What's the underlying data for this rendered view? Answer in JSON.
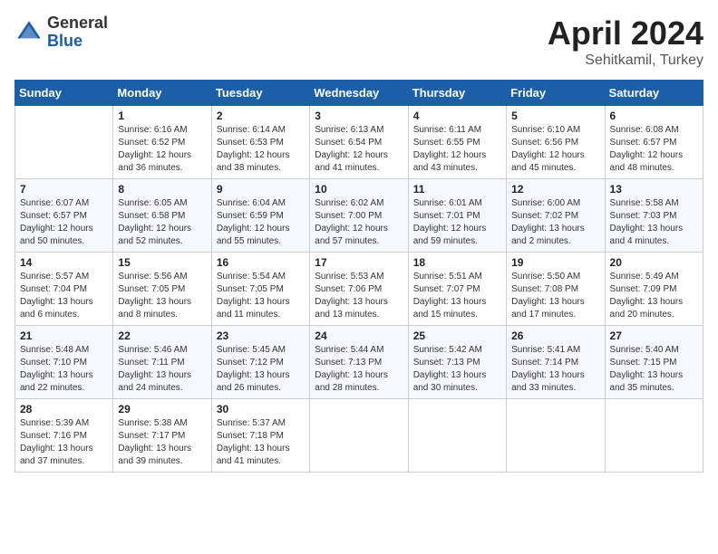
{
  "header": {
    "logo_general": "General",
    "logo_blue": "Blue",
    "month": "April 2024",
    "location": "Sehitkamil, Turkey"
  },
  "weekdays": [
    "Sunday",
    "Monday",
    "Tuesday",
    "Wednesday",
    "Thursday",
    "Friday",
    "Saturday"
  ],
  "weeks": [
    [
      {
        "day": "",
        "info": ""
      },
      {
        "day": "1",
        "info": "Sunrise: 6:16 AM\nSunset: 6:52 PM\nDaylight: 12 hours\nand 36 minutes."
      },
      {
        "day": "2",
        "info": "Sunrise: 6:14 AM\nSunset: 6:53 PM\nDaylight: 12 hours\nand 38 minutes."
      },
      {
        "day": "3",
        "info": "Sunrise: 6:13 AM\nSunset: 6:54 PM\nDaylight: 12 hours\nand 41 minutes."
      },
      {
        "day": "4",
        "info": "Sunrise: 6:11 AM\nSunset: 6:55 PM\nDaylight: 12 hours\nand 43 minutes."
      },
      {
        "day": "5",
        "info": "Sunrise: 6:10 AM\nSunset: 6:56 PM\nDaylight: 12 hours\nand 45 minutes."
      },
      {
        "day": "6",
        "info": "Sunrise: 6:08 AM\nSunset: 6:57 PM\nDaylight: 12 hours\nand 48 minutes."
      }
    ],
    [
      {
        "day": "7",
        "info": "Sunrise: 6:07 AM\nSunset: 6:57 PM\nDaylight: 12 hours\nand 50 minutes."
      },
      {
        "day": "8",
        "info": "Sunrise: 6:05 AM\nSunset: 6:58 PM\nDaylight: 12 hours\nand 52 minutes."
      },
      {
        "day": "9",
        "info": "Sunrise: 6:04 AM\nSunset: 6:59 PM\nDaylight: 12 hours\nand 55 minutes."
      },
      {
        "day": "10",
        "info": "Sunrise: 6:02 AM\nSunset: 7:00 PM\nDaylight: 12 hours\nand 57 minutes."
      },
      {
        "day": "11",
        "info": "Sunrise: 6:01 AM\nSunset: 7:01 PM\nDaylight: 12 hours\nand 59 minutes."
      },
      {
        "day": "12",
        "info": "Sunrise: 6:00 AM\nSunset: 7:02 PM\nDaylight: 13 hours\nand 2 minutes."
      },
      {
        "day": "13",
        "info": "Sunrise: 5:58 AM\nSunset: 7:03 PM\nDaylight: 13 hours\nand 4 minutes."
      }
    ],
    [
      {
        "day": "14",
        "info": "Sunrise: 5:57 AM\nSunset: 7:04 PM\nDaylight: 13 hours\nand 6 minutes."
      },
      {
        "day": "15",
        "info": "Sunrise: 5:56 AM\nSunset: 7:05 PM\nDaylight: 13 hours\nand 8 minutes."
      },
      {
        "day": "16",
        "info": "Sunrise: 5:54 AM\nSunset: 7:05 PM\nDaylight: 13 hours\nand 11 minutes."
      },
      {
        "day": "17",
        "info": "Sunrise: 5:53 AM\nSunset: 7:06 PM\nDaylight: 13 hours\nand 13 minutes."
      },
      {
        "day": "18",
        "info": "Sunrise: 5:51 AM\nSunset: 7:07 PM\nDaylight: 13 hours\nand 15 minutes."
      },
      {
        "day": "19",
        "info": "Sunrise: 5:50 AM\nSunset: 7:08 PM\nDaylight: 13 hours\nand 17 minutes."
      },
      {
        "day": "20",
        "info": "Sunrise: 5:49 AM\nSunset: 7:09 PM\nDaylight: 13 hours\nand 20 minutes."
      }
    ],
    [
      {
        "day": "21",
        "info": "Sunrise: 5:48 AM\nSunset: 7:10 PM\nDaylight: 13 hours\nand 22 minutes."
      },
      {
        "day": "22",
        "info": "Sunrise: 5:46 AM\nSunset: 7:11 PM\nDaylight: 13 hours\nand 24 minutes."
      },
      {
        "day": "23",
        "info": "Sunrise: 5:45 AM\nSunset: 7:12 PM\nDaylight: 13 hours\nand 26 minutes."
      },
      {
        "day": "24",
        "info": "Sunrise: 5:44 AM\nSunset: 7:13 PM\nDaylight: 13 hours\nand 28 minutes."
      },
      {
        "day": "25",
        "info": "Sunrise: 5:42 AM\nSunset: 7:13 PM\nDaylight: 13 hours\nand 30 minutes."
      },
      {
        "day": "26",
        "info": "Sunrise: 5:41 AM\nSunset: 7:14 PM\nDaylight: 13 hours\nand 33 minutes."
      },
      {
        "day": "27",
        "info": "Sunrise: 5:40 AM\nSunset: 7:15 PM\nDaylight: 13 hours\nand 35 minutes."
      }
    ],
    [
      {
        "day": "28",
        "info": "Sunrise: 5:39 AM\nSunset: 7:16 PM\nDaylight: 13 hours\nand 37 minutes."
      },
      {
        "day": "29",
        "info": "Sunrise: 5:38 AM\nSunset: 7:17 PM\nDaylight: 13 hours\nand 39 minutes."
      },
      {
        "day": "30",
        "info": "Sunrise: 5:37 AM\nSunset: 7:18 PM\nDaylight: 13 hours\nand 41 minutes."
      },
      {
        "day": "",
        "info": ""
      },
      {
        "day": "",
        "info": ""
      },
      {
        "day": "",
        "info": ""
      },
      {
        "day": "",
        "info": ""
      }
    ]
  ]
}
